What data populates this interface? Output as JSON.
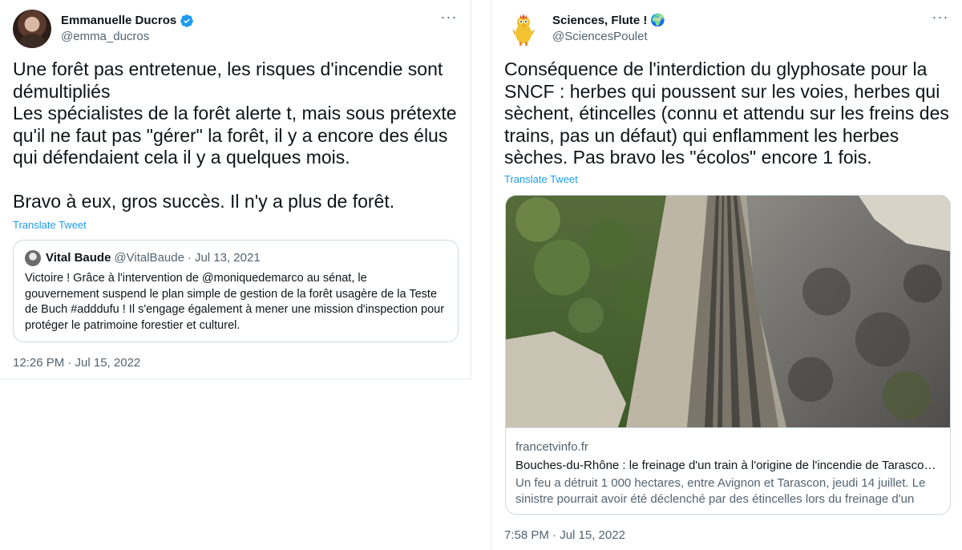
{
  "left_tweet": {
    "author": {
      "name": "Emmanuelle Ducros",
      "handle": "@emma_ducros"
    },
    "text": "Une forêt pas entretenue, les risques d'incendie sont\ndémultipliés\nLes spécialistes de la forêt alerte t, mais sous prétexte\nqu'il ne faut pas \"gérer\" la forêt, il y a encore des élus\nqui défendaient cela il y a quelques mois.\n\nBravo à eux, gros succès. Il n'y a plus de forêt.",
    "translate_label": "Translate Tweet",
    "quote": {
      "name": "Vital Baude",
      "handle": "@VitalBaude",
      "separator": "·",
      "date": "Jul 13, 2021",
      "text": "Victoire ! Grâce à l'intervention de @moniquedemarco au sénat, le\ngouvernement suspend le plan simple de gestion de la forêt usagère de la Teste\nde Buch #adddufu ! Il s'engage également à mener une mission d'inspection pour\nprotéger le patrimoine forestier et culturel."
    },
    "timestamp": "12:26 PM · Jul 15, 2022"
  },
  "right_tweet": {
    "author": {
      "name": "Sciences, Flute !",
      "handle": "@SciencesPoulet",
      "emoji": "🌍"
    },
    "text": "Conséquence de l'interdiction du glyphosate pour la\nSNCF : herbes qui poussent sur les voies, herbes qui\nsèchent, étincelles (connu et attendu sur les freins des\ntrains, pas un défaut) qui enflamment les herbes\nsèches. Pas bravo les \"écolos\" encore 1 fois.",
    "translate_label": "Translate Tweet",
    "card": {
      "domain": "francetvinfo.fr",
      "title": "Bouches-du-Rhône : le freinage d'un train à l'origine de l'incendie de Tarascon ?",
      "description": "Un feu a détruit 1 000 hectares, entre Avignon et Tarascon, jeudi 14 juillet. Le sinistre pourrait avoir été déclenché par des étincelles lors du freinage d'un trai..."
    },
    "timestamp": "7:58 PM · Jul 15, 2022"
  },
  "icons": {
    "more": "more-options-icon",
    "verified": "verified-badge-icon"
  },
  "colors": {
    "link": "#1d9bf0",
    "secondary_text": "#536471",
    "border": "#cfd9de",
    "verified": "#1d9bf0"
  }
}
